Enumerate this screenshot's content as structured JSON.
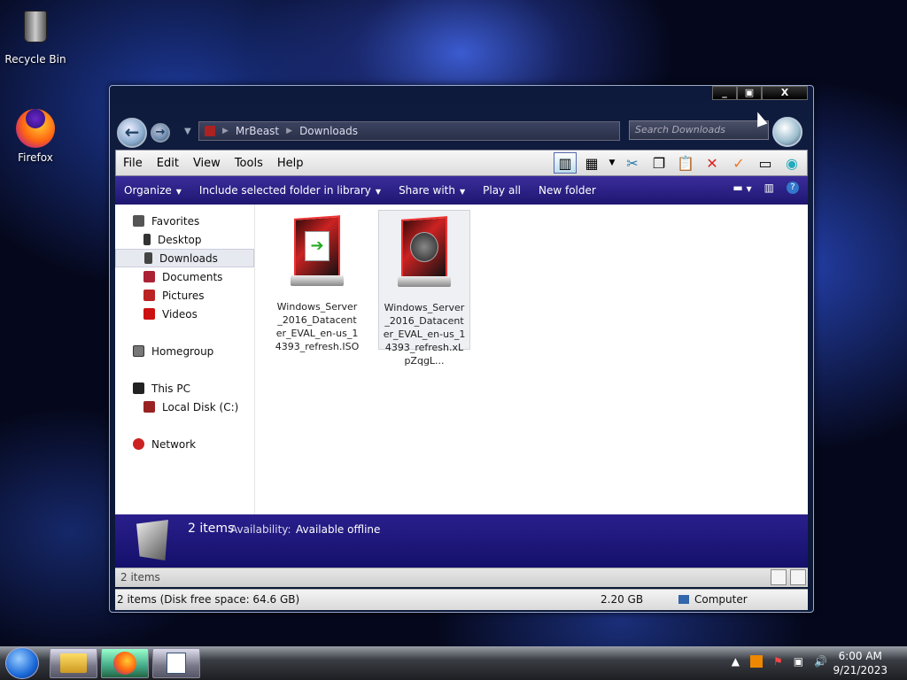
{
  "desktop": {
    "icons": [
      {
        "label": "Recycle Bin",
        "icon": "recycle-bin-icon"
      },
      {
        "label": "Firefox",
        "icon": "firefox-icon"
      }
    ]
  },
  "window": {
    "controls": {
      "minimize": "_",
      "maximize": "▣",
      "close": "X"
    },
    "breadcrumb": [
      "MrBeast",
      "Downloads"
    ],
    "search_placeholder": "Search Downloads",
    "menu": [
      "File",
      "Edit",
      "View",
      "Tools",
      "Help"
    ],
    "commands": {
      "organize": "Organize",
      "include": "Include selected folder in library",
      "share": "Share with",
      "play": "Play all",
      "new_folder": "New folder"
    },
    "nav": {
      "favorites": "Favorites",
      "desktop": "Desktop",
      "downloads": "Downloads",
      "documents": "Documents",
      "pictures": "Pictures",
      "videos": "Videos",
      "homegroup": "Homegroup",
      "this_pc": "This PC",
      "local_disk": "Local Disk (C:)",
      "network": "Network"
    },
    "files": [
      {
        "name": "Windows_Server_2016_Datacenter_EVAL_en-us_14393_refresh.ISO"
      },
      {
        "name": "Windows_Server_2016_Datacenter_EVAL_en-us_14393_refresh.xLpZqgL..."
      }
    ],
    "details": {
      "count": "2 items",
      "availability_label": "Availability:",
      "availability_value": "Available offline"
    },
    "status": {
      "items": "2 items"
    },
    "info": {
      "summary": "2 items (Disk free space: 64.6 GB)",
      "size": "2.20 GB",
      "location": "Computer"
    }
  },
  "taskbar": {
    "time": "6:00 AM",
    "date": "9/21/2023"
  }
}
